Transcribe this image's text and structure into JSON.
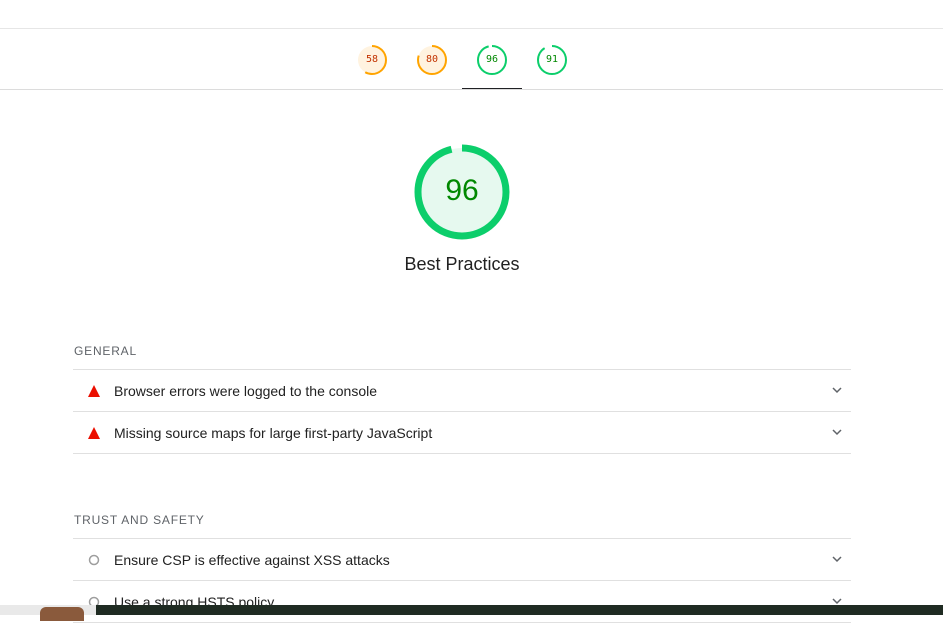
{
  "score_tabs": [
    {
      "score": "58",
      "progress": 0.58,
      "color": "#ffa400",
      "bg": "#fff3e0",
      "text_color": "#c33300"
    },
    {
      "score": "80",
      "progress": 0.8,
      "color": "#ffa400",
      "bg": "#fff3e0",
      "text_color": "#c33300"
    },
    {
      "score": "96",
      "progress": 0.96,
      "color": "#0cce6b",
      "bg": "#ffffff",
      "text_color": "#008800",
      "selected": true
    },
    {
      "score": "91",
      "progress": 0.91,
      "color": "#0cce6b",
      "bg": "#ffffff",
      "text_color": "#008800"
    }
  ],
  "category": {
    "score": "96",
    "progress": 0.96,
    "title": "Best Practices",
    "ring_color": "#0cce6b",
    "fill_color": "#e6f9ef",
    "text_color": "#008800"
  },
  "groups": [
    {
      "title": "GENERAL",
      "audits": [
        {
          "label": "Browser errors were logged to the console",
          "status": "fail"
        },
        {
          "label": "Missing source maps for large first-party JavaScript",
          "status": "fail"
        }
      ]
    },
    {
      "title": "TRUST AND SAFETY",
      "audits": [
        {
          "label": "Ensure CSP is effective against XSS attacks",
          "status": "info"
        },
        {
          "label": "Use a strong HSTS policy",
          "status": "info"
        }
      ]
    }
  ],
  "colors": {
    "fail": "#eb0f00",
    "info_outline": "#9e9e9e",
    "chevron": "#5f6368"
  }
}
